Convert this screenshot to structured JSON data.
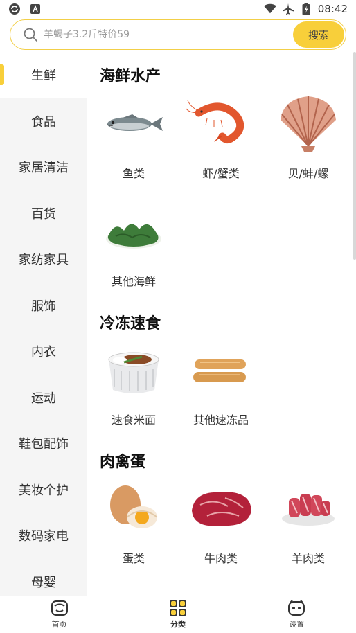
{
  "status_bar": {
    "time": "08:42",
    "left_icons": [
      "sync-icon",
      "text-icon"
    ],
    "right_icons": [
      "wifi-icon",
      "airplane-icon",
      "battery-icon"
    ]
  },
  "search": {
    "placeholder": "羊蝎子3.2斤特价59",
    "button_label": "搜索"
  },
  "sidebar": {
    "items": [
      {
        "label": "生鲜",
        "active": true
      },
      {
        "label": "食品"
      },
      {
        "label": "家居清洁"
      },
      {
        "label": "百货"
      },
      {
        "label": "家纺家具"
      },
      {
        "label": "服饰"
      },
      {
        "label": "内衣"
      },
      {
        "label": "运动"
      },
      {
        "label": "鞋包配饰"
      },
      {
        "label": "美妆个护"
      },
      {
        "label": "数码家电"
      },
      {
        "label": "母婴"
      }
    ]
  },
  "sections": [
    {
      "title": "海鲜水产",
      "items": [
        {
          "label": "鱼类",
          "icon": "fish-icon"
        },
        {
          "label": "虾/蟹类",
          "icon": "shrimp-icon"
        },
        {
          "label": "贝/蚌/螺",
          "icon": "scallop-icon"
        },
        {
          "label": "其他海鲜",
          "icon": "seaweed-icon"
        }
      ]
    },
    {
      "title": "冷冻速食",
      "items": [
        {
          "label": "速食米面",
          "icon": "rice-bowl-icon"
        },
        {
          "label": "其他速冻品",
          "icon": "sausage-icon"
        }
      ]
    },
    {
      "title": "肉禽蛋",
      "items": [
        {
          "label": "蛋类",
          "icon": "egg-icon"
        },
        {
          "label": "牛肉类",
          "icon": "beef-icon"
        },
        {
          "label": "羊肉类",
          "icon": "lamb-roll-icon"
        }
      ]
    }
  ],
  "bottom_nav": {
    "items": [
      {
        "label": "首页",
        "icon": "home-icon"
      },
      {
        "label": "分类",
        "icon": "category-icon",
        "active": true
      },
      {
        "label": "设置",
        "icon": "settings-icon"
      }
    ]
  },
  "colors": {
    "accent": "#f8cf3a",
    "search_border": "#f2cf48",
    "sidebar_bg": "#f5f5f5"
  }
}
